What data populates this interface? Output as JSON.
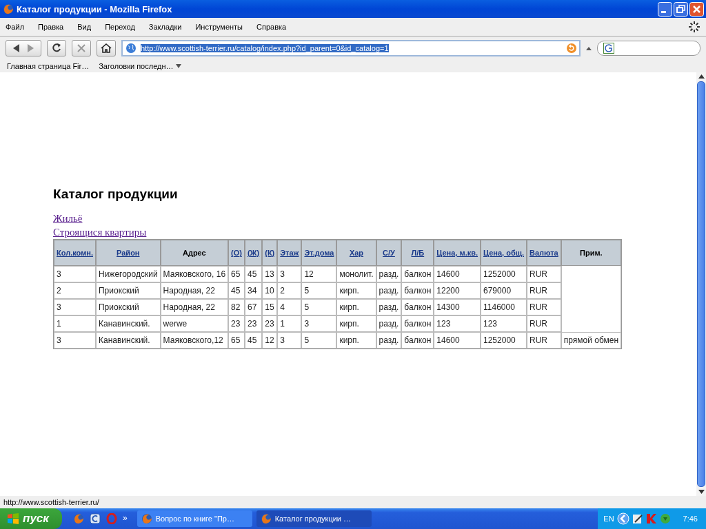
{
  "window": {
    "title": "Каталог продукции - Mozilla Firefox"
  },
  "menu": [
    "Файл",
    "Правка",
    "Вид",
    "Переход",
    "Закладки",
    "Инструменты",
    "Справка"
  ],
  "address_bar": {
    "value": "http://www.scottish-terrier.ru/catalog/index.php?id_parent=0&id_catalog=1"
  },
  "bookmarks": [
    {
      "label": "Главная страница Fir…",
      "kind": "plain"
    },
    {
      "label": "Заголовки последн…",
      "kind": "dropdown"
    }
  ],
  "page": {
    "heading": "Каталог продукции",
    "links": [
      "Жильё",
      "Строящися квартиры"
    ],
    "table": {
      "columns": [
        {
          "label": "Кол.комн.",
          "kind": "link"
        },
        {
          "label": "Район",
          "kind": "link"
        },
        {
          "label": "Адрес",
          "kind": "plain"
        },
        {
          "label": "(О)",
          "kind": "link"
        },
        {
          "label": "(Ж)",
          "kind": "link"
        },
        {
          "label": "(К)",
          "kind": "link"
        },
        {
          "label": "Этаж",
          "kind": "link"
        },
        {
          "label": "Эт.дома",
          "kind": "link"
        },
        {
          "label": "Хар",
          "kind": "link"
        },
        {
          "label": "С/У",
          "kind": "link"
        },
        {
          "label": "Л/Б",
          "kind": "link"
        },
        {
          "label": "Цена, м.кв.",
          "kind": "link"
        },
        {
          "label": "Цена, общ.",
          "kind": "link"
        },
        {
          "label": "Валюта",
          "kind": "link"
        },
        {
          "label": "Прим.",
          "kind": "plain"
        }
      ],
      "rows": [
        {
          "cells": [
            "3",
            "Нижегородский",
            "Маяковского, 16",
            "65",
            "45",
            "13",
            "3",
            "12",
            "монолит.",
            "разд.",
            "балкон",
            "14600",
            "1252000",
            "RUR"
          ]
        },
        {
          "cells": [
            "2",
            "Приокский",
            "Народная, 22",
            "45",
            "34",
            "10",
            "2",
            "5",
            "кирп.",
            "разд.",
            "балкон",
            "12200",
            "679000",
            "RUR"
          ]
        },
        {
          "cells": [
            "3",
            "Приокский",
            "Народная, 22",
            "82",
            "67",
            "15",
            "4",
            "5",
            "кирп.",
            "разд.",
            "балкон",
            "14300",
            "1146000",
            "RUR"
          ]
        },
        {
          "cells": [
            "1",
            "Канавинский.",
            "werwe",
            "23",
            "23",
            "23",
            "1",
            "3",
            "кирп.",
            "разд.",
            "балкон",
            "123",
            "123",
            "RUR"
          ]
        },
        {
          "cells": [
            "3",
            "Канавинский.",
            "Маяковского,12",
            "65",
            "45",
            "12",
            "3",
            "5",
            "кирп.",
            "разд.",
            "балкон",
            "14600",
            "1252000",
            "RUR"
          ],
          "note": "прямой обмен"
        }
      ]
    }
  },
  "status_bar": {
    "text": "http://www.scottish-terrier.ru/"
  },
  "taskbar": {
    "start": "пуск",
    "more": "»",
    "tasks": [
      {
        "label": "Вопрос по книге \"Пр…",
        "selected": false
      },
      {
        "label": "Каталог продукции …",
        "selected": true
      }
    ],
    "language": "EN",
    "clock": "7:46"
  }
}
